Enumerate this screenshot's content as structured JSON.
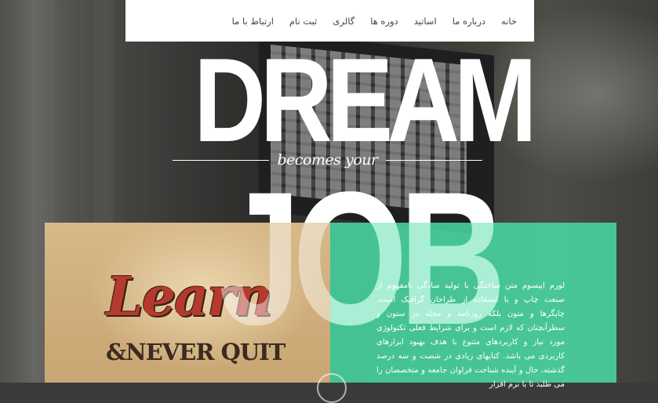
{
  "nav": {
    "items": [
      {
        "label": "خانه"
      },
      {
        "label": "درباره ما"
      },
      {
        "label": "اساتید"
      },
      {
        "label": "دوره ها"
      },
      {
        "label": "گالری"
      },
      {
        "label": "ثبت نام"
      },
      {
        "label": "ارتباط با ما"
      }
    ]
  },
  "hero": {
    "word1": "DREAM",
    "connector": "becomes your",
    "word2": "JOB"
  },
  "card": {
    "image_title": "Learn",
    "image_subtitle": "&NEVER QUIT",
    "body": "لورم ایپسوم متن ساختگی با تولید سادگی نامفهوم از صنعت چاپ و با استفاده از طراحان گرافیک است. چاپگرها و متون بلکه روزنامه و مجله در ستون و سطرآنچنان که لازم است و برای شرایط فعلی تکنولوژی مورد نیاز و کاربردهای متنوع با هدف بهبود ابزارهای کاربردی می باشد. کتابهای زیادی در شصت و سه درصد گذشته، حال و آینده شناخت فراوان جامعه و متخصصان را می طلبد تا با نرم افزار"
  },
  "colors": {
    "accent": "#48dca5",
    "nav_bg": "#ffffff",
    "hero_text": "#ffffff"
  }
}
